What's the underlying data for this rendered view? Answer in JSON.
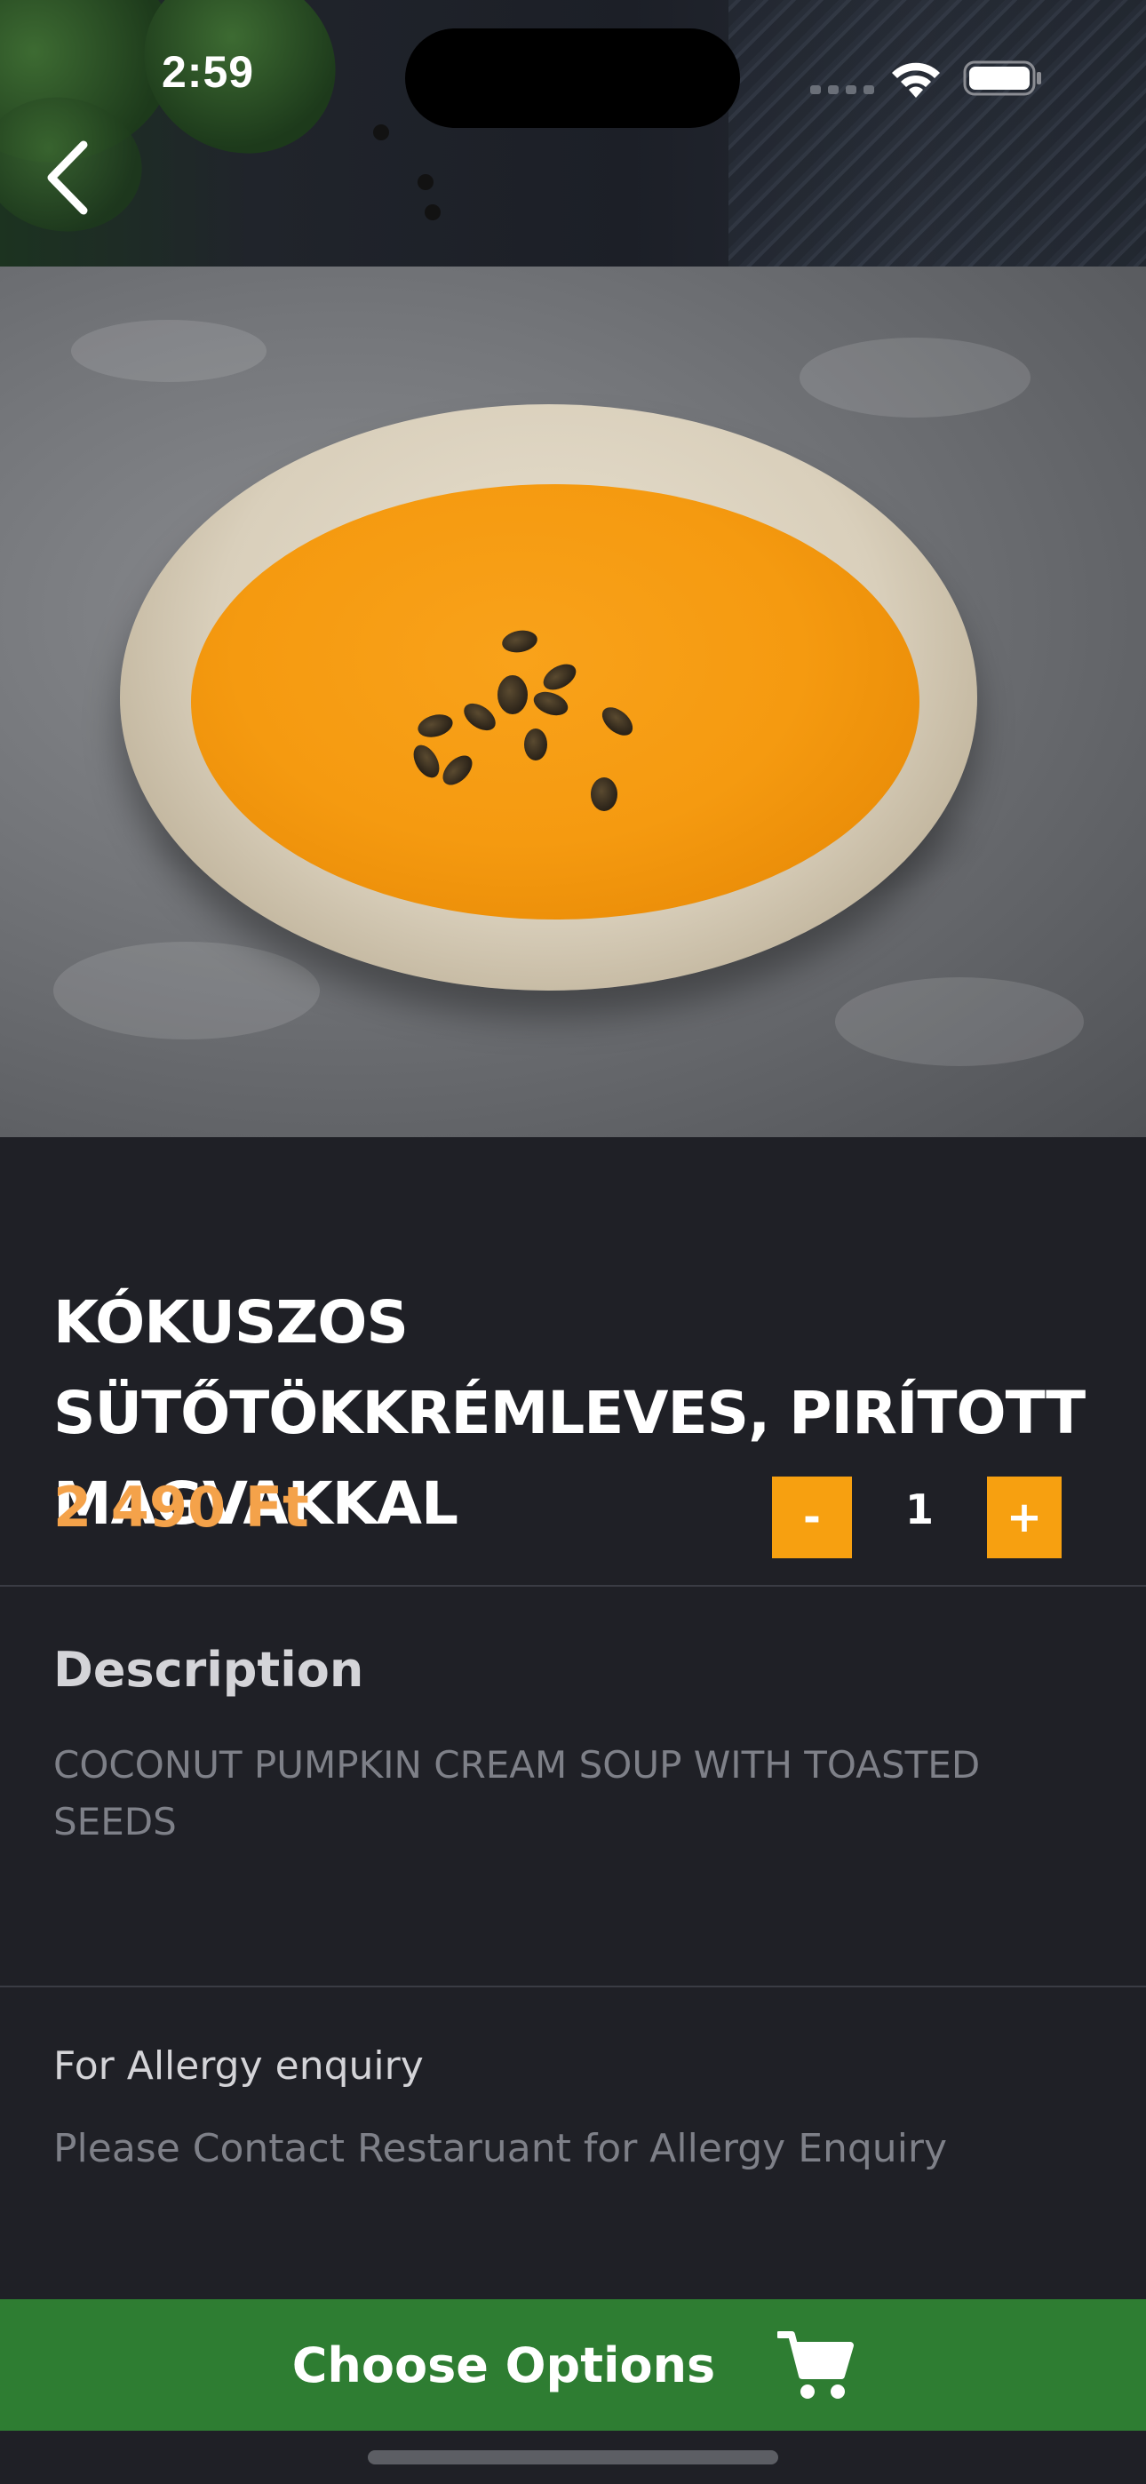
{
  "status_bar": {
    "time": "2:59"
  },
  "icons": {
    "back": "chevron-left-icon",
    "wifi": "wifi-icon",
    "battery": "battery-icon",
    "cart": "cart-icon"
  },
  "product": {
    "title": "KÓKUSZOS SÜTŐTÖKKRÉMLEVES, PIRÍTOTT MAGVAKKAL",
    "price": "2 490 Ft",
    "quantity": "1",
    "minus_label": "-",
    "plus_label": "+"
  },
  "description": {
    "heading": "Description",
    "text": "COCONUT PUMPKIN CREAM SOUP WITH TOASTED SEEDS"
  },
  "allergy": {
    "heading": "For Allergy enquiry",
    "text": "Please Contact Restaruant for Allergy Enquiry"
  },
  "footer": {
    "button_label": "Choose Options"
  },
  "colors": {
    "background": "#1f2026",
    "price": "#f4a24a",
    "quantity_button": "#f7a010",
    "primary_button": "#2e7d32"
  }
}
